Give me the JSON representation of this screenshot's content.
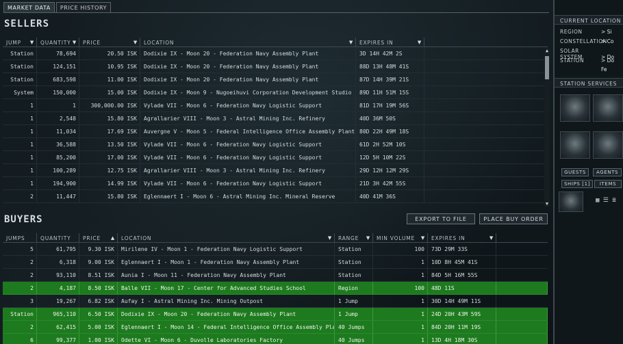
{
  "tabs": [
    "MARKET DATA",
    "PRICE HISTORY"
  ],
  "sellers": {
    "title": "SELLERS",
    "columns": [
      "JUMP",
      "QUANTITY",
      "PRICE",
      "LOCATION",
      "EXPIRES IN"
    ],
    "rows": [
      [
        "Station",
        "78,694",
        "20.50 ISK",
        "Dodixie IX - Moon 20 - Federation Navy Assembly Plant",
        "3D 14H 42M 2S"
      ],
      [
        "Station",
        "124,151",
        "10.95 ISK",
        "Dodixie IX - Moon 20 - Federation Navy Assembly Plant",
        "88D 13H 48M 41S"
      ],
      [
        "Station",
        "683,598",
        "11.00 ISK",
        "Dodixie IX - Moon 20 - Federation Navy Assembly Plant",
        "87D 14H 39M 21S"
      ],
      [
        "System",
        "150,000",
        "15.00 ISK",
        "Dodixie IX - Moon 9 - Nugoeihuvi Corporation Development Studio",
        "89D 11H 51M 15S"
      ],
      [
        "1",
        "1",
        "300,000.00 ISK",
        "Vylade VII - Moon 6 - Federation Navy Logistic Support",
        "81D 17H 19M 56S"
      ],
      [
        "1",
        "2,548",
        "15.80 ISK",
        "Agrallarier VIII - Moon 3 - Astral Mining Inc. Refinery",
        "40D 36M 50S"
      ],
      [
        "1",
        "11,034",
        "17.69 ISK",
        "Auvergne V - Moon 5 - Federal Intelligence Office Assembly Plant",
        "80D 22H 49M 18S"
      ],
      [
        "1",
        "36,588",
        "13.50 ISK",
        "Vylade VII - Moon 6 - Federation Navy Logistic Support",
        "61D 2H 52M 10S"
      ],
      [
        "1",
        "85,200",
        "17.00 ISK",
        "Vylade VII - Moon 6 - Federation Navy Logistic Support",
        "12D 5H 10M 22S"
      ],
      [
        "1",
        "100,289",
        "12.75 ISK",
        "Agrallarier VIII - Moon 3 - Astral Mining Inc. Refinery",
        "29D 12H 12M 29S"
      ],
      [
        "1",
        "194,900",
        "14.99 ISK",
        "Vylade VII - Moon 6 - Federation Navy Logistic Support",
        "21D 3H 42M 55S"
      ],
      [
        "2",
        "11,447",
        "15.80 ISK",
        "Eglennaert I - Moon 6 - Astral Mining Inc. Mineral Reserve",
        "40D 41M 36S"
      ]
    ]
  },
  "buyers": {
    "title": "BUYERS",
    "columns": [
      "JUMPS",
      "QUANTITY",
      "PRICE",
      "LOCATION",
      "RANGE",
      "MIN VOLUME",
      "EXPIRES IN"
    ],
    "rows": [
      {
        "cells": [
          "5",
          "61,795",
          "9.30 ISK",
          "Mirilene IV - Moon 1 - Federation Navy Logistic Support",
          "Station",
          "100",
          "73D 29M 33S"
        ],
        "highlight": false
      },
      {
        "cells": [
          "2",
          "6,318",
          "9.00 ISK",
          "Eglennaert I - Moon 1 - Federation Navy Assembly Plant",
          "Station",
          "1",
          "10D 8H 45M 41S"
        ],
        "highlight": false
      },
      {
        "cells": [
          "2",
          "93,110",
          "8.51 ISK",
          "Aunia I - Moon 11 - Federation Navy Assembly Plant",
          "Station",
          "1",
          "84D 5H 16M 55S"
        ],
        "highlight": false
      },
      {
        "cells": [
          "2",
          "4,187",
          "8.50 ISK",
          "Balle VII - Moon 17 - Center for Advanced Studies School",
          "Region",
          "100",
          "48D 11S"
        ],
        "highlight": true
      },
      {
        "cells": [
          "3",
          "19,267",
          "6.82 ISK",
          "Aufay I - Astral Mining Inc. Mining Outpost",
          "1 Jump",
          "1",
          "30D 14H 49M 11S"
        ],
        "highlight": false
      },
      {
        "cells": [
          "Station",
          "965,110",
          "6.50 ISK",
          "Dodixie IX - Moon 20 - Federation Navy Assembly Plant",
          "1 Jump",
          "1",
          "24D 20H 43M 59S"
        ],
        "highlight": true
      },
      {
        "cells": [
          "2",
          "62,415",
          "5.00 ISK",
          "Eglennaert I - Moon 14 - Federal Intelligence Office Assembly Plant",
          "40 Jumps",
          "1",
          "84D 20H 11M 19S"
        ],
        "highlight": true
      },
      {
        "cells": [
          "6",
          "99,377",
          "1.00 ISK",
          "Odette VI - Moon 6 - Duvolle Laboratories Factory",
          "40 Jumps",
          "1",
          "13D 4H 18M 30S"
        ],
        "highlight": true
      }
    ],
    "export_label": "EXPORT TO FILE",
    "place_buy_label": "PLACE BUY ORDER"
  },
  "right_panel": {
    "current_location_label": "CURRENT LOCATION",
    "location": [
      {
        "k": "REGION",
        "v": "> Si"
      },
      {
        "k": "CONSTELLATION",
        "v": "> Co"
      },
      {
        "k": "SOLAR SYSTEM",
        "v": "> Do"
      },
      {
        "k": "STATION",
        "v": "> Do"
      }
    ],
    "station_extra": "Fe",
    "station_services_label": "STATION SERVICES",
    "buttons": [
      "GUESTS",
      "AGENTS",
      "SHIPS [1]",
      "ITEMS"
    ]
  }
}
